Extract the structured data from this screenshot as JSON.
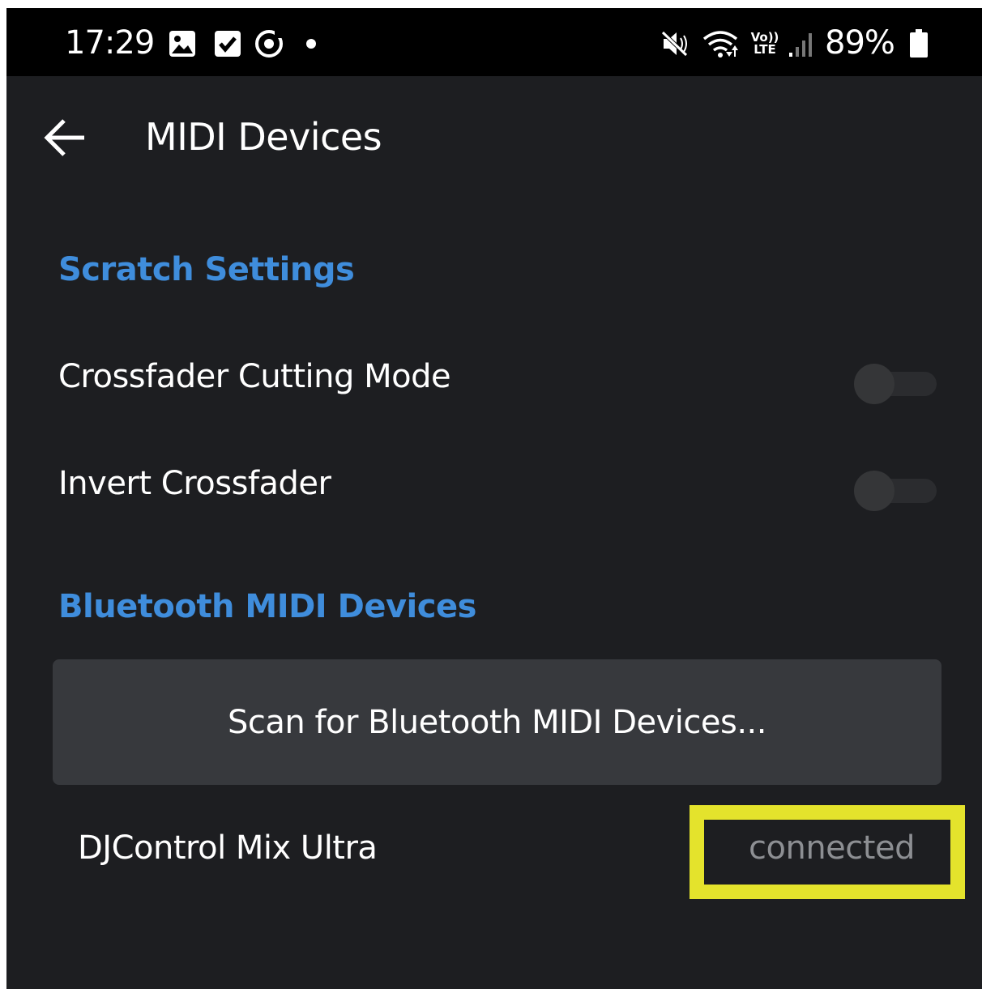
{
  "status_bar": {
    "time": "17:29",
    "left_icons": [
      "gallery-icon",
      "checkbox-icon",
      "sync-icon",
      "dot-icon"
    ],
    "right_icons": [
      "mute-icon",
      "wifi-icon",
      "volte-icon",
      "signal-icon"
    ],
    "volte_label_top": "Vo))",
    "volte_label_bottom": "LTE",
    "battery_percent": "89%"
  },
  "app_bar": {
    "back_icon": "arrow-left-icon",
    "title": "MIDI Devices"
  },
  "scratch_section": {
    "header": "Scratch Settings",
    "settings": [
      {
        "label": "Crossfader Cutting Mode",
        "enabled": false
      },
      {
        "label": "Invert Crossfader",
        "enabled": false
      }
    ]
  },
  "bluetooth_section": {
    "header": "Bluetooth MIDI Devices",
    "scan_button_label": "Scan for Bluetooth MIDI Devices...",
    "devices": [
      {
        "name": "DJControl Mix Ultra",
        "status": "connected"
      }
    ]
  },
  "colors": {
    "accent": "#3f8ddc",
    "background": "#1d1e21",
    "highlight": "#e4e32c"
  }
}
